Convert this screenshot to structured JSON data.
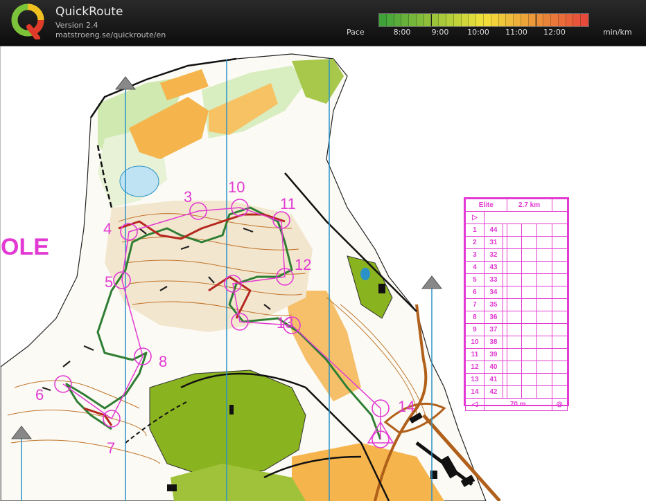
{
  "header": {
    "title": "QuickRoute",
    "version": "Version 2.4",
    "url": "matstroeng.se/quickroute/en",
    "pace_label": "Pace",
    "pace_unit": "min/km",
    "pace_ticks": [
      "8:00",
      "9:00",
      "10:00",
      "11:00",
      "12:00"
    ],
    "colors": {
      "fast": "#3fa33a",
      "mid": "#f2e33a",
      "slow": "#e64a3a",
      "background": "#161616"
    }
  },
  "map": {
    "partial_text": "OLE",
    "control_numbers": [
      "3",
      "4",
      "5",
      "6",
      "7",
      "8",
      "10",
      "11",
      "12",
      "13",
      "14"
    ],
    "colors": {
      "course": "#e23ad2",
      "route": "#2f7e34",
      "route_slow": "#b5281f",
      "north_lines": "#2a92c8",
      "forest": "#8ab320",
      "open": "#f4b84a"
    }
  },
  "description_sheet": {
    "class": "Elite",
    "length": "2.7 km",
    "rows": [
      {
        "no": "1",
        "code": "44"
      },
      {
        "no": "2",
        "code": "31"
      },
      {
        "no": "3",
        "code": "32"
      },
      {
        "no": "4",
        "code": "43"
      },
      {
        "no": "5",
        "code": "33"
      },
      {
        "no": "6",
        "code": "34"
      },
      {
        "no": "7",
        "code": "35"
      },
      {
        "no": "8",
        "code": "36"
      },
      {
        "no": "9",
        "code": "37"
      },
      {
        "no": "10",
        "code": "38"
      },
      {
        "no": "11",
        "code": "39"
      },
      {
        "no": "12",
        "code": "40"
      },
      {
        "no": "13",
        "code": "41"
      },
      {
        "no": "14",
        "code": "42"
      }
    ],
    "finish_distance": "70 m"
  }
}
